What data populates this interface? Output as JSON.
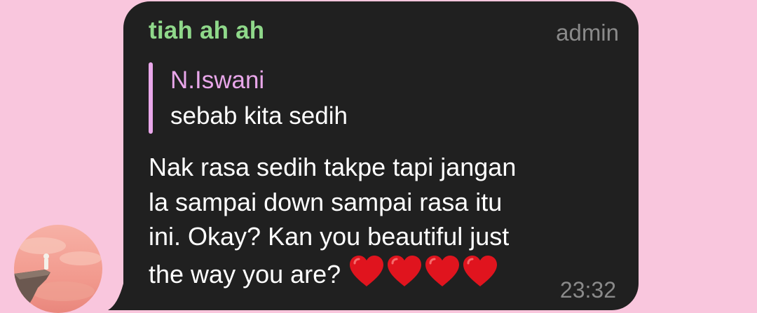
{
  "avatar": {
    "icon": "cliff-sunset-avatar-icon"
  },
  "message": {
    "sender_name": "tiah ah ah",
    "sender_color": "#8fd88a",
    "role_badge": "admin",
    "reply": {
      "author": "N.Iswani",
      "author_color": "#e9a7ea",
      "text": "sebab kita sedih"
    },
    "body_lines": [
      "Nak rasa sedih takpe tapi jangan",
      "la sampai down sampai rasa itu",
      "ini. Okay? Kan you beautiful just",
      "the way you are?"
    ],
    "emoji": [
      "heart-icon",
      "heart-icon",
      "heart-icon",
      "heart-icon"
    ],
    "emoji_color": "#e0141e",
    "time": "23:32"
  },
  "colors": {
    "background": "#f9c6dd",
    "bubble": "#202020",
    "muted_text": "#8a8a8a"
  }
}
